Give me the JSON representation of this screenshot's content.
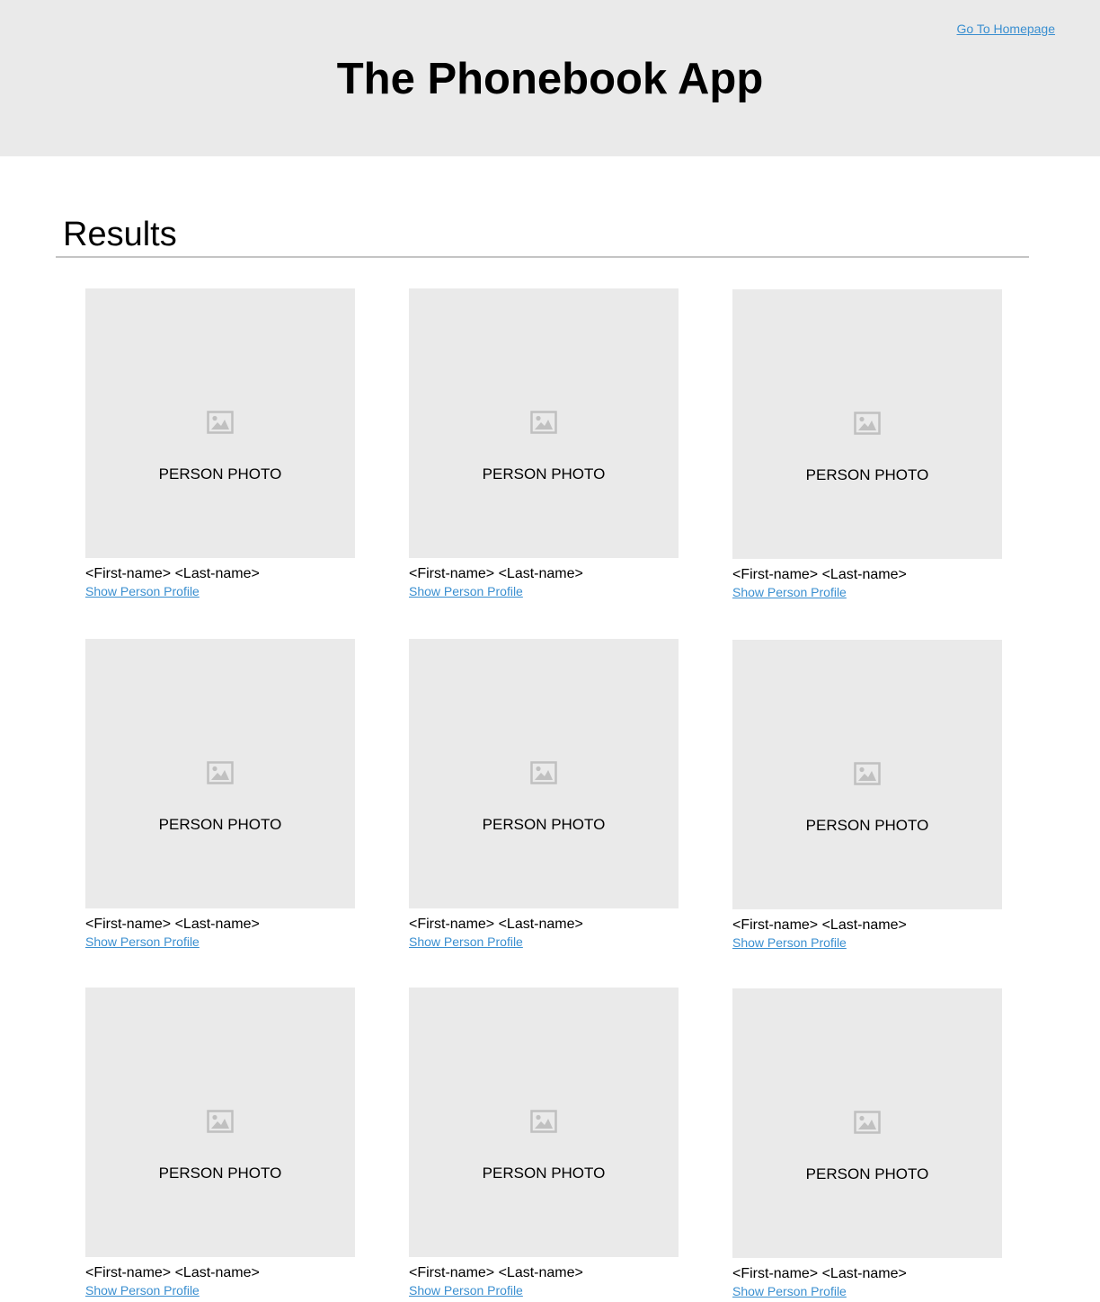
{
  "header": {
    "title": "The Phonebook App",
    "home_link": "Go To Homepage",
    "background": "#eaeaea"
  },
  "results": {
    "title": "Results",
    "cards": [
      {
        "photo_label": "PERSON PHOTO",
        "photo_icon": "image-placeholder-icon",
        "name": "<First-name> <Last-name>",
        "link": "Show Person Profile"
      },
      {
        "photo_label": "PERSON PHOTO",
        "photo_icon": "image-placeholder-icon",
        "name": "<First-name> <Last-name>",
        "link": "Show Person Profile"
      },
      {
        "photo_label": "PERSON PHOTO",
        "photo_icon": "image-placeholder-icon",
        "name": "<First-name> <Last-name>",
        "link": "Show Person Profile"
      },
      {
        "photo_label": "PERSON PHOTO",
        "photo_icon": "image-placeholder-icon",
        "name": "<First-name> <Last-name>",
        "link": "Show Person Profile"
      },
      {
        "photo_label": "PERSON PHOTO",
        "photo_icon": "image-placeholder-icon",
        "name": "<First-name> <Last-name>",
        "link": "Show Person Profile"
      },
      {
        "photo_label": "PERSON PHOTO",
        "photo_icon": "image-placeholder-icon",
        "name": "<First-name> <Last-name>",
        "link": "Show Person Profile"
      },
      {
        "photo_label": "PERSON PHOTO",
        "photo_icon": "image-placeholder-icon",
        "name": "<First-name> <Last-name>",
        "link": "Show Person Profile"
      },
      {
        "photo_label": "PERSON PHOTO",
        "photo_icon": "image-placeholder-icon",
        "name": "<First-name> <Last-name>",
        "link": "Show Person Profile"
      },
      {
        "photo_label": "PERSON PHOTO",
        "photo_icon": "image-placeholder-icon",
        "name": "<First-name> <Last-name>",
        "link": "Show Person Profile"
      }
    ]
  },
  "colors": {
    "link": "#3a8fd0",
    "placeholder": "#eaeaea",
    "icon": "#c0c0c0",
    "divider": "#c4c4c4"
  }
}
